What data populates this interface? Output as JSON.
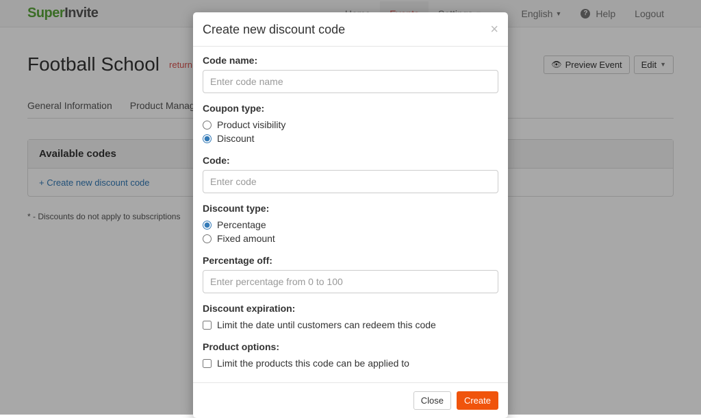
{
  "logo": {
    "part1": "Super",
    "part2": "Invite"
  },
  "nav": {
    "home": "Home",
    "events": "Events",
    "settings": "Settings",
    "language": "English",
    "help": "Help",
    "logout": "Logout"
  },
  "page": {
    "title": "Football School",
    "return_link": "return to event list",
    "preview_btn": "Preview Event",
    "edit_btn": "Edit"
  },
  "tabs": {
    "general": "General Information",
    "products": "Product Management"
  },
  "panel": {
    "heading": "Available codes",
    "create_link": "+ Create new discount code"
  },
  "footnote": "* - Discounts do not apply to subscriptions",
  "modal": {
    "title": "Create new discount code",
    "code_name_label": "Code name:",
    "code_name_placeholder": "Enter code name",
    "coupon_type_label": "Coupon type:",
    "coupon_type_visibility": "Product visibility",
    "coupon_type_discount": "Discount",
    "code_label": "Code:",
    "code_placeholder": "Enter code",
    "discount_type_label": "Discount type:",
    "discount_type_percentage": "Percentage",
    "discount_type_fixed": "Fixed amount",
    "percentage_off_label": "Percentage off:",
    "percentage_off_placeholder": "Enter percentage from 0 to 100",
    "expiration_label": "Discount expiration:",
    "expiration_check": "Limit the date until customers can redeem this code",
    "product_options_label": "Product options:",
    "product_options_check": "Limit the products this code can be applied to",
    "close_btn": "Close",
    "create_btn": "Create"
  }
}
